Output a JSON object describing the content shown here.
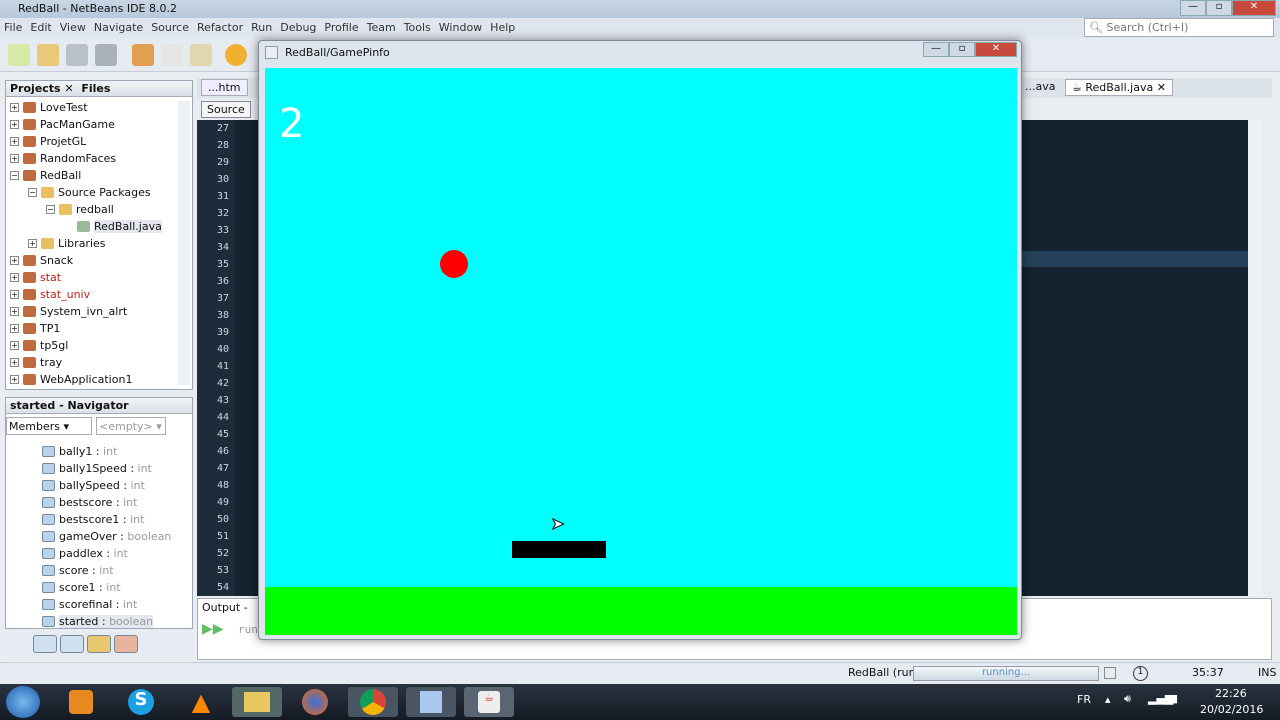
{
  "window": {
    "title": "RedBall - NetBeans IDE 8.0.2"
  },
  "menu": [
    "File",
    "Edit",
    "View",
    "Navigate",
    "Source",
    "Refactor",
    "Run",
    "Debug",
    "Profile",
    "Team",
    "Tools",
    "Window",
    "Help"
  ],
  "search": {
    "placeholder": "Search (Ctrl+I)"
  },
  "projects": {
    "tab_projects": "Projects",
    "tab_files": "Files",
    "items": [
      {
        "label": "LoveTest",
        "level": 0,
        "red": false
      },
      {
        "label": "PacManGame",
        "level": 0,
        "red": false
      },
      {
        "label": "ProjetGL",
        "level": 0,
        "red": false
      },
      {
        "label": "RandomFaces",
        "level": 0,
        "red": false
      },
      {
        "label": "RedBall",
        "level": 0,
        "red": false
      },
      {
        "label": "Source Packages",
        "level": 1,
        "red": false
      },
      {
        "label": "redball",
        "level": 2,
        "red": false
      },
      {
        "label": "RedBall.java",
        "level": 3,
        "red": false
      },
      {
        "label": "Libraries",
        "level": 1,
        "red": false
      },
      {
        "label": "Snack",
        "level": 0,
        "red": false
      },
      {
        "label": "stat",
        "level": 0,
        "red": true
      },
      {
        "label": "stat_univ",
        "level": 0,
        "red": true
      },
      {
        "label": "System_ivn_alrt",
        "level": 0,
        "red": false
      },
      {
        "label": "TP1",
        "level": 0,
        "red": false
      },
      {
        "label": "tp5gl",
        "level": 0,
        "red": false
      },
      {
        "label": "tray",
        "level": 0,
        "red": false
      },
      {
        "label": "WebApplication1",
        "level": 0,
        "red": false
      }
    ]
  },
  "navigator": {
    "title": "started - Navigator",
    "filter": "Members",
    "filter2": "<empty>",
    "members": [
      {
        "name": "bally1",
        "type": "int"
      },
      {
        "name": "bally1Speed",
        "type": "int"
      },
      {
        "name": "ballySpeed",
        "type": "int"
      },
      {
        "name": "bestscore",
        "type": "int"
      },
      {
        "name": "bestscore1",
        "type": "int"
      },
      {
        "name": "gameOver",
        "type": "boolean"
      },
      {
        "name": "paddlex",
        "type": "int"
      },
      {
        "name": "score",
        "type": "int"
      },
      {
        "name": "score1",
        "type": "int"
      },
      {
        "name": "scorefinal",
        "type": "int"
      },
      {
        "name": "started",
        "type": "boolean"
      }
    ]
  },
  "editor": {
    "tabs": [
      "...htm",
      "...ava",
      "RedBall.java"
    ],
    "source_tab": "Source",
    "line_numbers": [
      "27",
      "28",
      "29",
      "30",
      "31",
      "32",
      "33",
      "34",
      "35",
      "36",
      "37",
      "38",
      "39",
      "40",
      "41",
      "42",
      "43",
      "44",
      "45",
      "46",
      "47",
      "48",
      "49",
      "50",
      "51",
      "52",
      "53",
      "54"
    ]
  },
  "output": {
    "title": "Output -",
    "text": "run"
  },
  "game": {
    "title": "RedBall/GamePinfo",
    "score": "2",
    "colors": {
      "sky": "#00ffff",
      "ground": "#00ff00",
      "ball": "#ff0000",
      "paddle": "#000000"
    }
  },
  "status": {
    "task": "RedBall (run)",
    "progress": "running...",
    "position": "35:37",
    "mode": "INS",
    "notifications": "1"
  },
  "taskbar": {
    "lang": "FR",
    "time": "22:26",
    "date": "20/02/2016"
  }
}
